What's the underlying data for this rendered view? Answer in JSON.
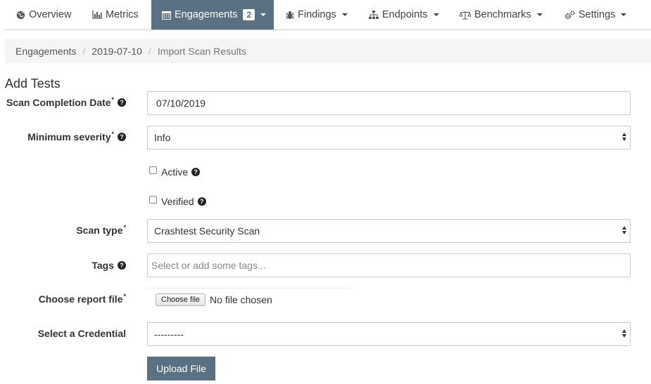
{
  "nav": {
    "items": [
      {
        "label": "Overview",
        "icon": "globe-icon"
      },
      {
        "label": "Metrics",
        "icon": "bar-chart-icon"
      },
      {
        "label": "Engagements",
        "icon": "calendar-icon",
        "badge": "2",
        "active": true
      },
      {
        "label": "Findings",
        "icon": "bug-icon"
      },
      {
        "label": "Endpoints",
        "icon": "sitemap-icon"
      },
      {
        "label": "Benchmarks",
        "icon": "balance-scale-icon"
      },
      {
        "label": "Settings",
        "icon": "gears-icon"
      }
    ],
    "active_color": "#5a7083"
  },
  "breadcrumb": {
    "items": [
      "Engagements",
      "2019-07-10",
      "Import Scan Results"
    ]
  },
  "page": {
    "heading": "Add Tests"
  },
  "form": {
    "scan_completion_date": {
      "label": "Scan Completion Date",
      "value": "07/10/2019"
    },
    "minimum_severity": {
      "label": "Minimum severity",
      "value": "Info"
    },
    "active": {
      "label": "Active",
      "checked": false
    },
    "verified": {
      "label": "Verified",
      "checked": false
    },
    "scan_type": {
      "label": "Scan type",
      "value": "Crashtest Security Scan"
    },
    "tags": {
      "label": "Tags",
      "placeholder": "Select or add some tags..."
    },
    "report_file": {
      "label": "Choose report file",
      "button": "Choose file",
      "status": "No file chosen"
    },
    "credential": {
      "label": "Select a Credential",
      "value": "---------"
    },
    "submit_label": "Upload File",
    "required_mark": "*",
    "help_mark": "?"
  }
}
